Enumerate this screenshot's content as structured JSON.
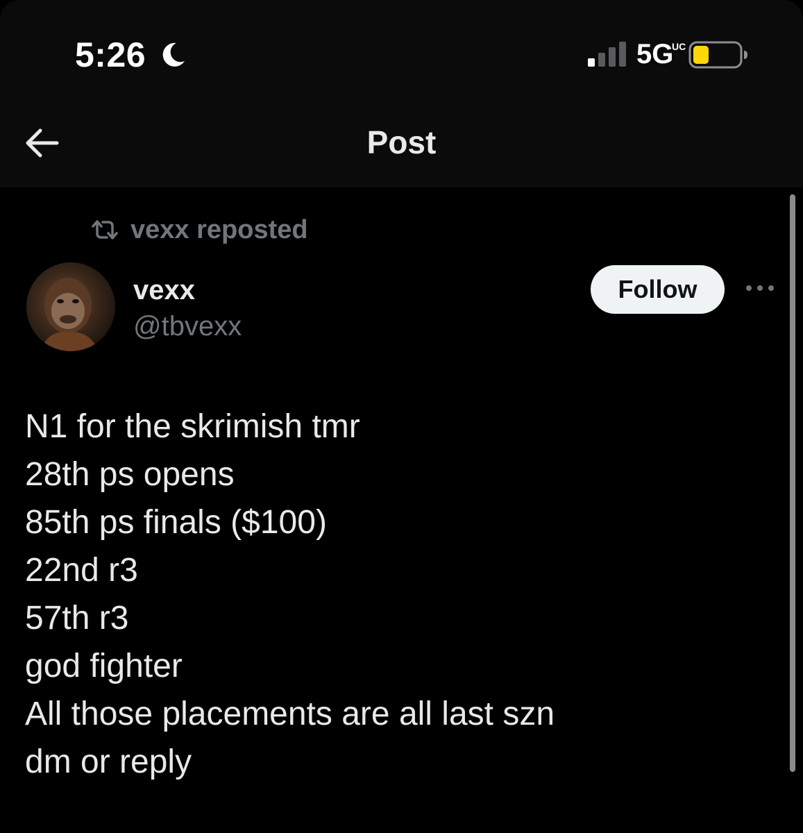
{
  "status_bar": {
    "time": "5:26",
    "network": "5G",
    "network_suffix": "UC",
    "signal_bars_active": 1,
    "signal_bars_total": 4,
    "battery_level": 0.35,
    "battery_color": "#ffd60a",
    "icons": [
      "moon-icon",
      "signal-icon",
      "battery-icon"
    ]
  },
  "header": {
    "title": "Post",
    "back_icon": "back-arrow-icon"
  },
  "post": {
    "repost_label": "vexx reposted",
    "author": {
      "display_name": "vexx",
      "handle": "@tbvexx"
    },
    "follow_label": "Follow",
    "more_icon": "more-options-icon",
    "lines": [
      "N1 for the skrimish tmr",
      "28th ps opens",
      "85th ps finals ($100)",
      "22nd r3",
      "57th r3",
      "god fighter",
      "All those placements are all last szn",
      "dm or reply"
    ]
  },
  "colors": {
    "background": "#000000",
    "header_background": "#0b0b0b",
    "primary_text": "#e7e9ea",
    "secondary_text": "#71767b",
    "follow_button_bg": "#eff3f4"
  }
}
